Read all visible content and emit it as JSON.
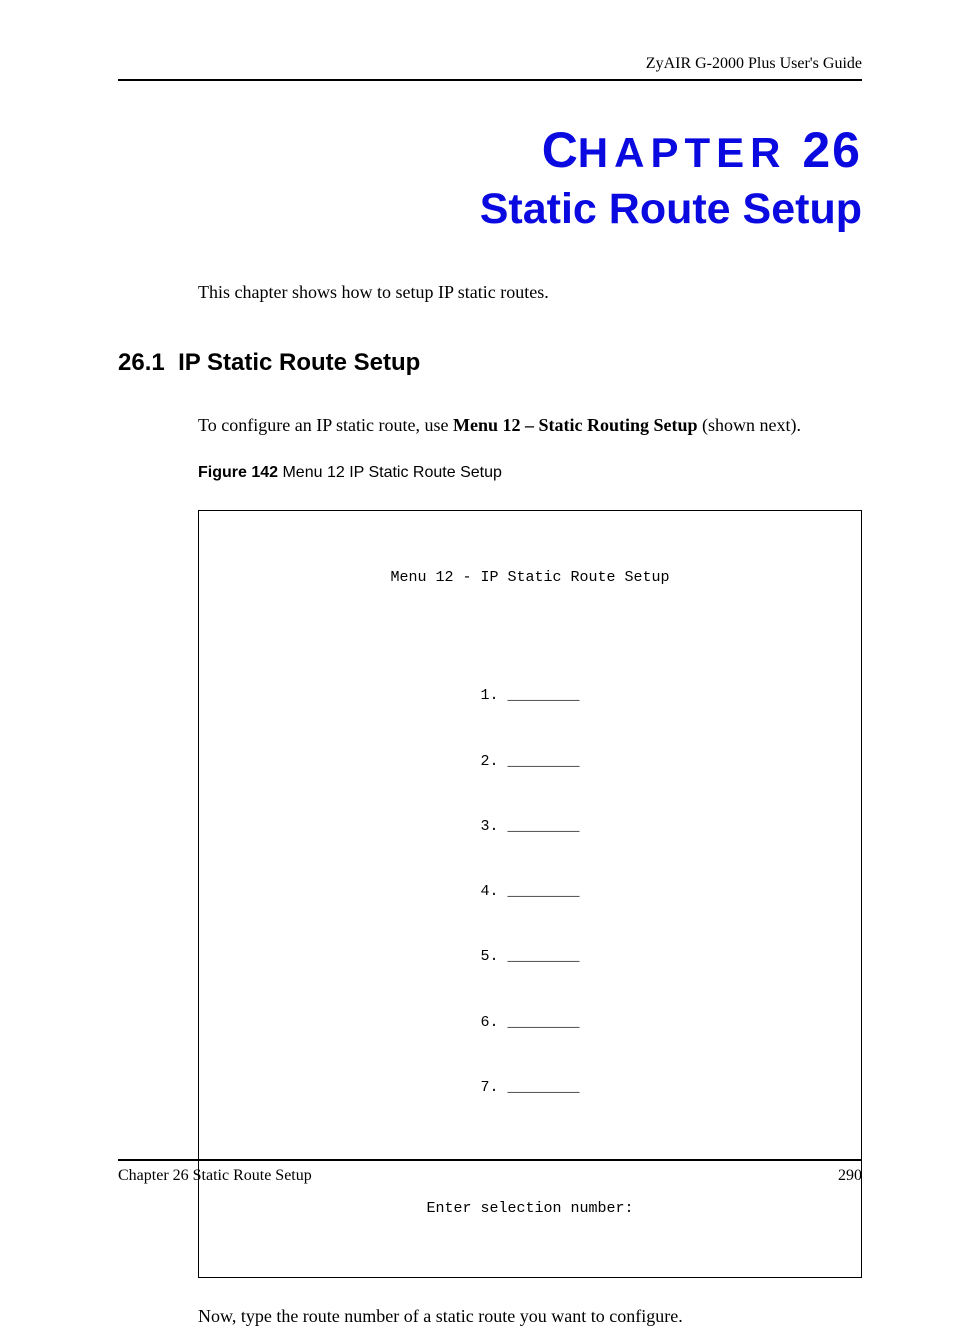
{
  "header": {
    "guide_title": "ZyAIR G-2000 Plus User's Guide"
  },
  "chapter": {
    "label_c": "C",
    "label_rest": "HAPTER",
    "label_num": " 26",
    "title": "Static Route Setup"
  },
  "intro": "This chapter shows how to setup IP static routes.",
  "section": {
    "number": "26.1",
    "title": "IP Static Route Setup"
  },
  "body1_before": "To configure an IP static route, use ",
  "body1_bold": "Menu 12 – Static Routing Setup",
  "body1_after": " (shown next).",
  "figure": {
    "label": "Figure 142",
    "caption": "   Menu 12 IP Static Route Setup"
  },
  "menu": {
    "title": "Menu 12 - IP Static Route Setup",
    "entries": [
      "1. ________",
      "2. ________",
      "3. ________",
      "4. ________",
      "5. ________",
      "6. ________",
      "7. ________"
    ],
    "prompt": "Enter selection number:"
  },
  "body2": "Now, type the route number of a static route you want to configure.",
  "footer": {
    "left": "Chapter 26 Static Route Setup",
    "right": "290"
  }
}
